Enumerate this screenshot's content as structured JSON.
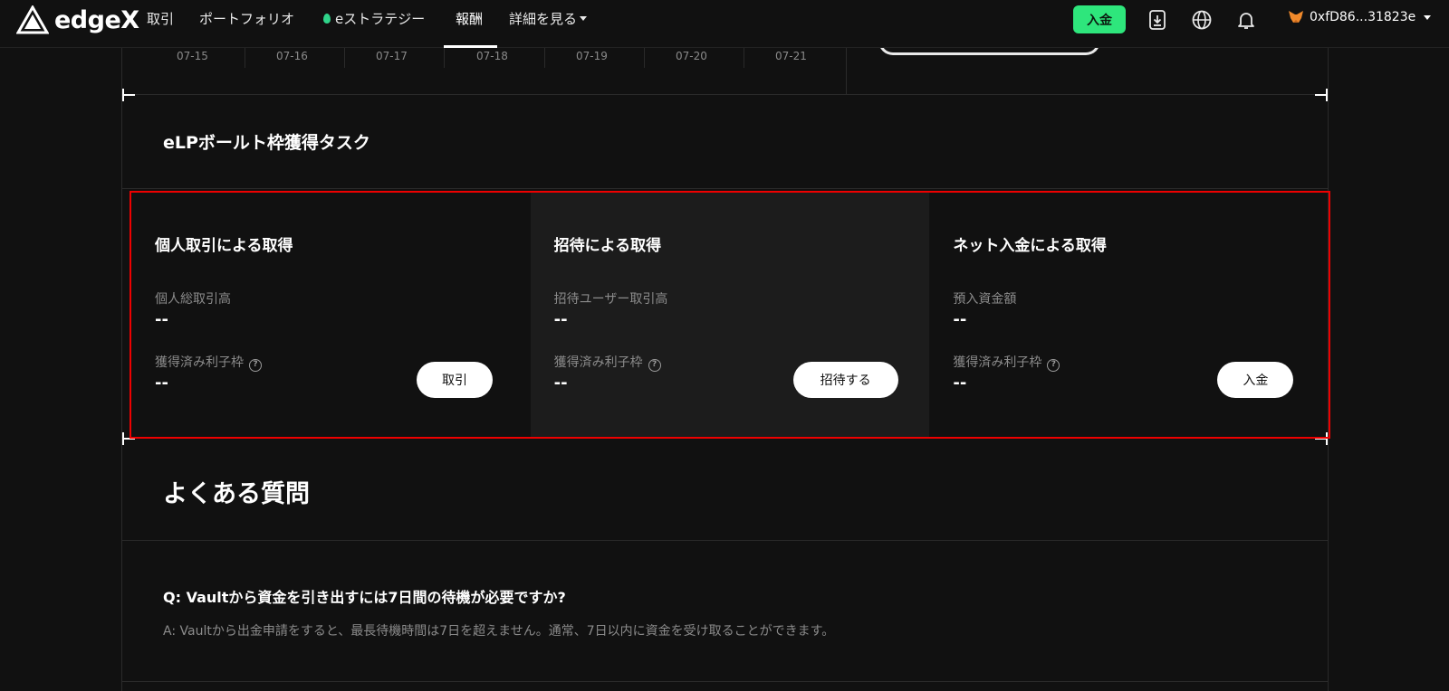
{
  "brand": {
    "name": "edgeX"
  },
  "nav": {
    "items": [
      {
        "label": "取引"
      },
      {
        "label": "ポートフォリオ"
      },
      {
        "label": "eストラテジー"
      },
      {
        "label": "報酬"
      },
      {
        "label": "詳細を見る"
      }
    ],
    "active": "報酬",
    "deposit_label": "入金",
    "wallet_address": "0xfD86...31823e"
  },
  "chart_axis": {
    "dates": [
      "07-15",
      "07-16",
      "07-17",
      "07-18",
      "07-19",
      "07-20",
      "07-21"
    ]
  },
  "tasks": {
    "title": "eLPボールト枠獲得タスク",
    "cards": [
      {
        "title": "個人取引による取得",
        "metric_label": "個人総取引高",
        "metric_value": "--",
        "earned_label": "獲得済み利子枠",
        "earned_value": "--",
        "button": "取引"
      },
      {
        "title": "招待による取得",
        "metric_label": "招待ユーザー取引高",
        "metric_value": "--",
        "earned_label": "獲得済み利子枠",
        "earned_value": "--",
        "button": "招待する"
      },
      {
        "title": "ネット入金による取得",
        "metric_label": "預入資金額",
        "metric_value": "--",
        "earned_label": "獲得済み利子枠",
        "earned_value": "--",
        "button": "入金"
      }
    ]
  },
  "faq": {
    "title": "よくある質問",
    "items": [
      {
        "q": "Q:  Vaultから資金を引き出すには7日間の待機が必要ですか?",
        "a": "A:  Vaultから出金申請をすると、最長待機時間は7日を超えません。通常、7日以内に資金を受け取ることができます。"
      }
    ]
  },
  "colors": {
    "accent_green": "#2ee67c",
    "highlight_border": "#ee0000",
    "background": "#111111"
  }
}
